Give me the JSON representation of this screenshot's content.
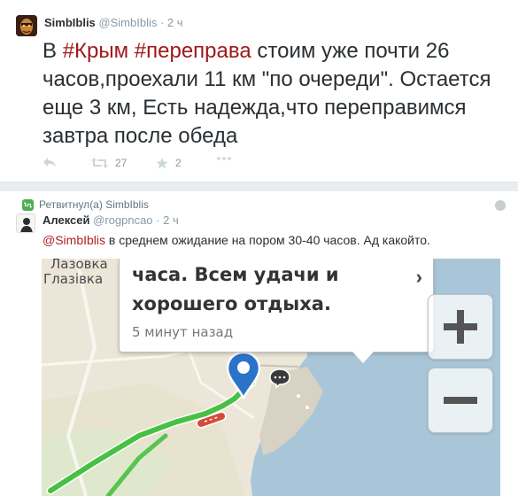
{
  "tweet1": {
    "author_name": "SimbIblis",
    "author_handle": "@SimbIblis",
    "time": "· 2 ч",
    "text_pre": "В ",
    "tag1": "#Крым",
    "text_mid": " ",
    "tag2": "#переправа",
    "text_post": " стоим уже почти 26 часов,проехали 11 км \"по очереди\". Остается еще 3 км, Есть надежда,что переправимся завтра после обеда",
    "retweets": "27",
    "favorites": "2"
  },
  "tweet2": {
    "retweeted_by": "Ретвитнул(а) SimbIblis",
    "author_name": "Алексей",
    "author_handle": "@rogpncao",
    "time": "· 2 ч",
    "mention": "@SimbIblis",
    "text": " в среднем ожидание на пором 30-40 часов. Ад какойто."
  },
  "map_image": {
    "town_top": "Лазовка",
    "town_bottom": "Глазiвка",
    "bubble_line1": "часа. Всем удачи и",
    "bubble_line2": "хорошего отдыха.",
    "bubble_time": "5 минут назад",
    "bubble_chevron": "›"
  },
  "colors": {
    "hashtag": "#a0181b",
    "mention": "#b02225",
    "retweet_green": "#4caf50",
    "sea": "#a9c6d8"
  },
  "icons": [
    "reply-icon",
    "retweet-icon",
    "star-icon",
    "more-icon",
    "globe-icon",
    "location-pin-icon",
    "chat-bubble-icon",
    "zoom-in-icon",
    "zoom-out-icon"
  ]
}
